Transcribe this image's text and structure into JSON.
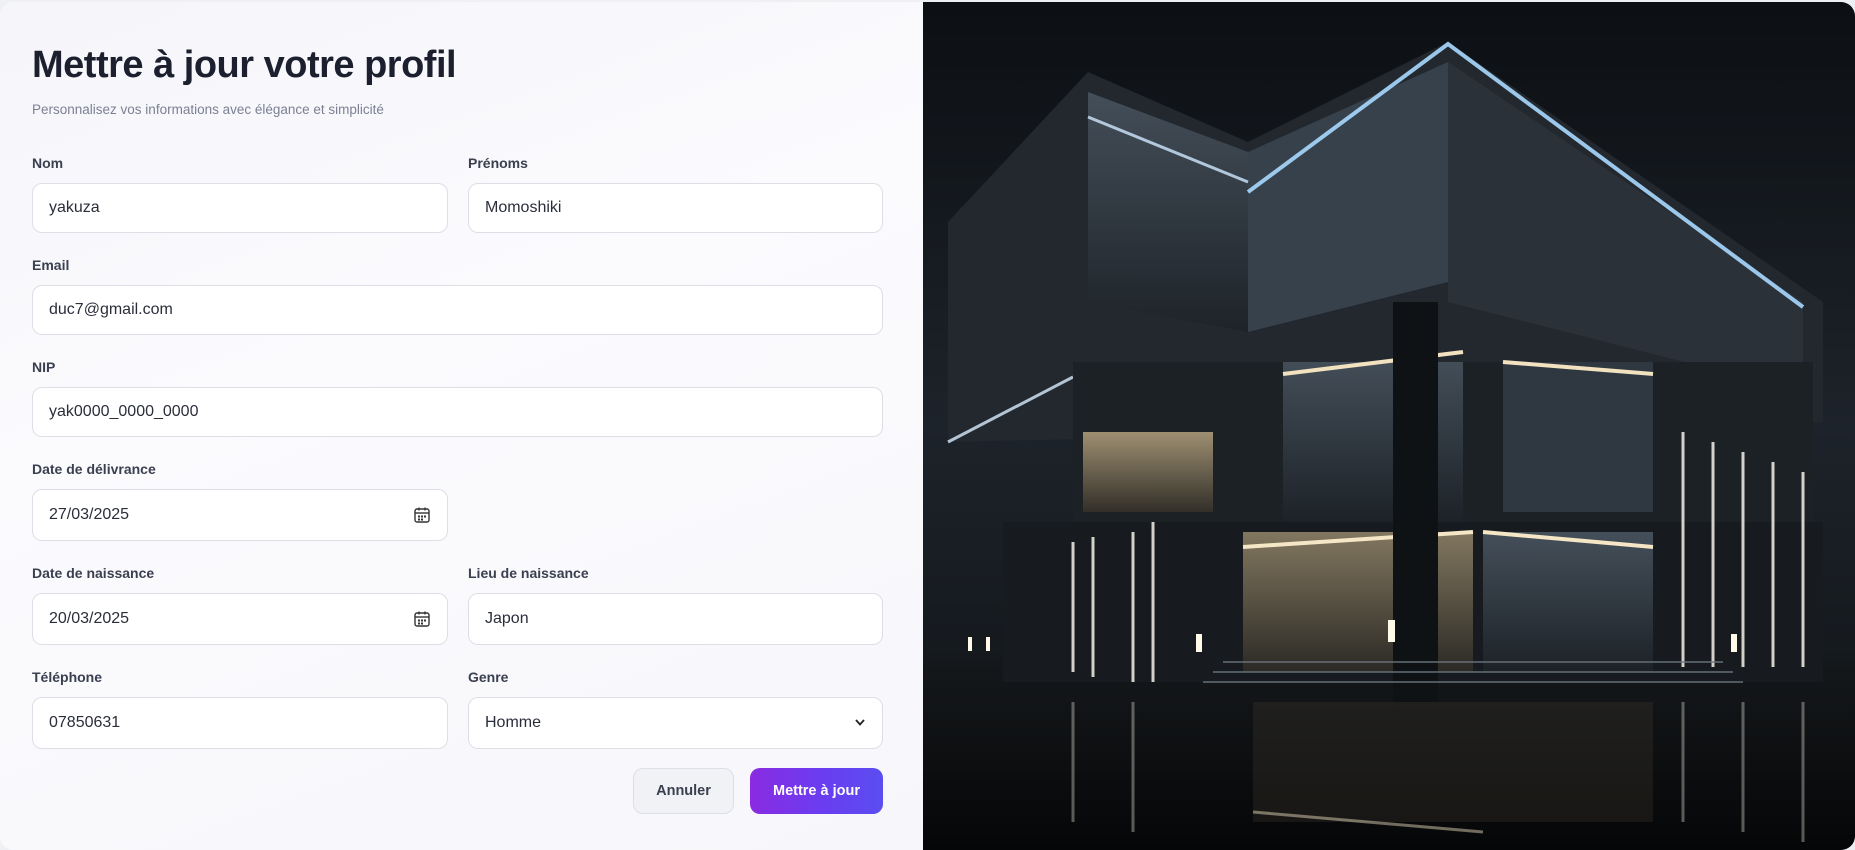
{
  "header": {
    "title": "Mettre à jour votre profil",
    "subtitle": "Personnalisez vos informations avec élégance et simplicité"
  },
  "form": {
    "nom": {
      "label": "Nom",
      "value": "yakuza"
    },
    "prenoms": {
      "label": "Prénoms",
      "value": "Momoshiki"
    },
    "email": {
      "label": "Email",
      "value": "duc7@gmail.com"
    },
    "nip": {
      "label": "NIP",
      "value": "yak0000_0000_0000"
    },
    "date_delivrance": {
      "label": "Date de délivrance",
      "value": "27/03/2025"
    },
    "date_naissance": {
      "label": "Date de naissance",
      "value": "20/03/2025"
    },
    "lieu_naissance": {
      "label": "Lieu de naissance",
      "value": "Japon"
    },
    "telephone": {
      "label": "Téléphone",
      "value": "07850631"
    },
    "genre": {
      "label": "Genre",
      "value": "Homme"
    }
  },
  "actions": {
    "cancel_label": "Annuler",
    "submit_label": "Mettre à jour"
  },
  "colors": {
    "accent_start": "#8a2be2",
    "accent_end": "#5a4ef0",
    "title": "#1b1f2e"
  },
  "icons": {
    "date_picker": "calendar-icon",
    "select_caret": "chevron-down-icon"
  }
}
